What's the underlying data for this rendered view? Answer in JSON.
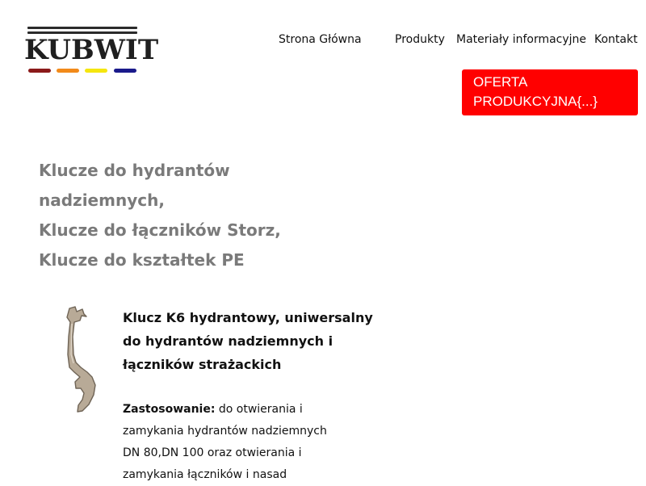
{
  "logo": {
    "text": "KUBWIT",
    "dash_colors": [
      "#8b1a1a",
      "#f28a1a",
      "#f5e60f",
      "#1a1a8b"
    ]
  },
  "nav": {
    "items": [
      {
        "label": "Strona Główna"
      },
      {
        "label": "Produkty"
      },
      {
        "label": "Materiały informacyjne"
      },
      {
        "label": "Kontakt"
      }
    ]
  },
  "cta": {
    "line1": "OFERTA",
    "line2": "PRODUKCYJNA{...}",
    "color": "#ff0000"
  },
  "heading": {
    "lines": [
      "Klucze do hydrantów",
      "nadziemnych,",
      "Klucze do łączników Storz,",
      "Klucze do kształtek PE"
    ]
  },
  "product": {
    "title_lines": [
      "Klucz K6 hydrantowy, uniwersalny",
      "do hydrantów nadziemnych i",
      "łączników strażackich"
    ],
    "usage_label": "Zastosowanie:",
    "desc_lines": [
      " do otwierania i",
      "zamykania hydrantów nadziemnych",
      "DN 80,DN 100 oraz otwierania i",
      "zamykania łączników i nasad"
    ]
  }
}
